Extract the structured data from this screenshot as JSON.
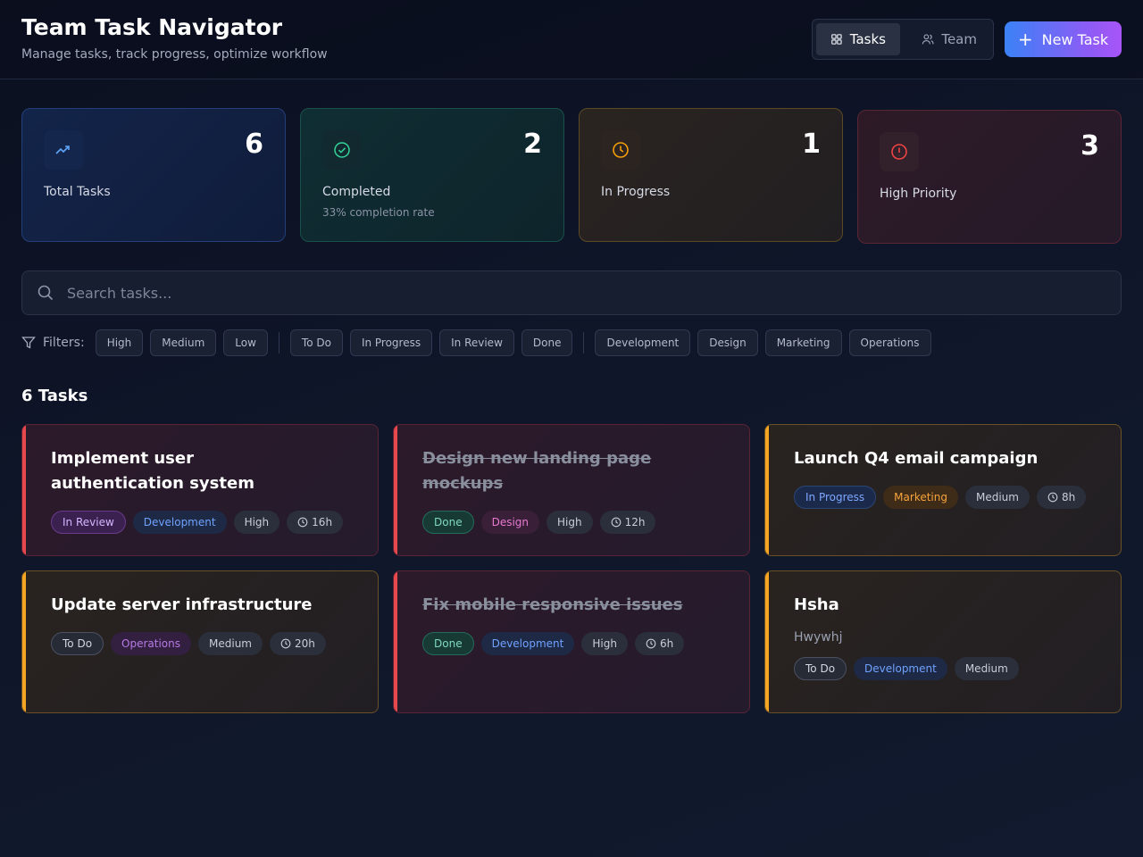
{
  "header": {
    "title": "Team Task Navigator",
    "subtitle": "Manage tasks, track progress, optimize workflow",
    "tabs": [
      {
        "label": "Tasks",
        "icon": "grid-icon",
        "active": true
      },
      {
        "label": "Team",
        "icon": "users-icon",
        "active": false
      }
    ],
    "new_task_label": "New Task"
  },
  "stats": {
    "total": {
      "value": "6",
      "label": "Total Tasks",
      "icon": "trending-up-icon",
      "color": "#60a5fa"
    },
    "completed": {
      "value": "2",
      "label": "Completed",
      "sub": "33% completion rate",
      "icon": "check-circle-icon",
      "color": "#34d399"
    },
    "in_progress": {
      "value": "1",
      "label": "In Progress",
      "icon": "clock-icon",
      "color": "#f59e0b"
    },
    "high_priority": {
      "value": "3",
      "label": "High Priority",
      "icon": "alert-circle-icon",
      "color": "#ef4444"
    }
  },
  "search": {
    "placeholder": "Search tasks..."
  },
  "filters": {
    "label": "Filters:",
    "priority": [
      "High",
      "Medium",
      "Low"
    ],
    "status": [
      "To Do",
      "In Progress",
      "In Review",
      "Done"
    ],
    "category": [
      "Development",
      "Design",
      "Marketing",
      "Operations"
    ]
  },
  "tasks_title": "6 Tasks",
  "tasks": [
    {
      "title": "Implement user authentication system",
      "status": "In Review",
      "category": "Development",
      "priority": "High",
      "hours": "16h",
      "done": false
    },
    {
      "title": "Design new landing page mockups",
      "status": "Done",
      "category": "Design",
      "priority": "High",
      "hours": "12h",
      "done": true
    },
    {
      "title": "Launch Q4 email campaign",
      "status": "In Progress",
      "category": "Marketing",
      "priority": "Medium",
      "hours": "8h",
      "done": false
    },
    {
      "title": "Update server infrastructure",
      "status": "To Do",
      "category": "Operations",
      "priority": "Medium",
      "hours": "20h",
      "done": false
    },
    {
      "title": "Fix mobile responsive issues",
      "status": "Done",
      "category": "Development",
      "priority": "High",
      "hours": "6h",
      "done": true
    },
    {
      "title": "Hsha",
      "description": "Hwywhj",
      "status": "To Do",
      "category": "Development",
      "priority": "Medium",
      "done": false
    }
  ],
  "colors": {
    "accent_blue": "#3b82f6",
    "accent_purple": "#a855f7",
    "high": "#e5484d",
    "medium": "#f5a524"
  }
}
